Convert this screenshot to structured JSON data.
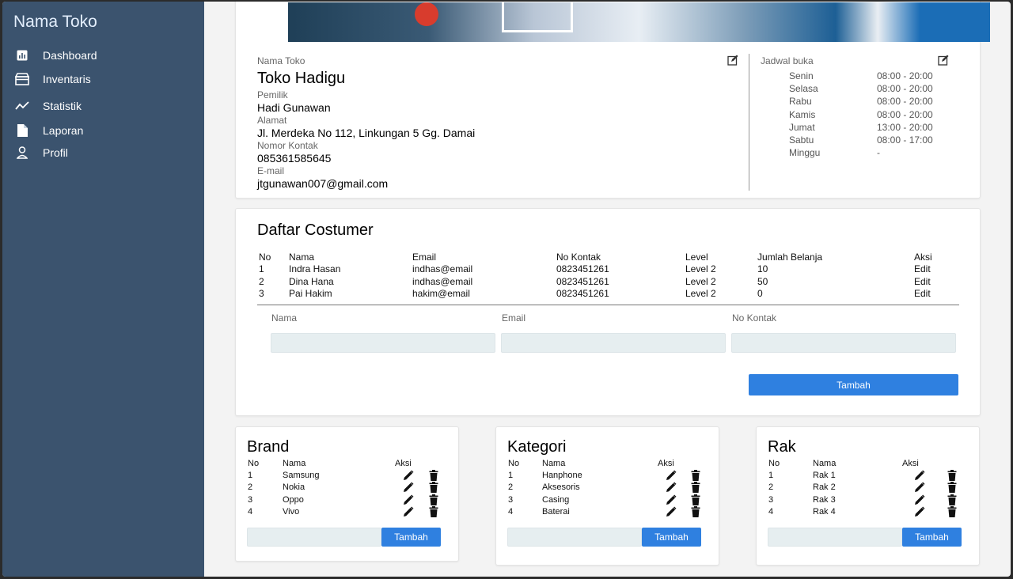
{
  "app": {
    "title": "Nama Toko"
  },
  "sidebar": {
    "items": [
      {
        "label": "Dashboard",
        "icon": "bar-chart-icon"
      },
      {
        "label": "Inventaris",
        "icon": "storefront-icon"
      },
      {
        "label": "Statistik",
        "icon": "trend-icon"
      },
      {
        "label": "Laporan",
        "icon": "document-icon"
      },
      {
        "label": "Profil",
        "icon": "person-icon"
      }
    ]
  },
  "store": {
    "name_label": "Nama Toko",
    "name": "Toko Hadigu",
    "owner_label": "Pemilik",
    "owner": "Hadi Gunawan",
    "address_label": "Alamat",
    "address": "Jl. Merdeka No 112, Linkungan 5 Gg. Damai",
    "contact_label": "Nomor Kontak",
    "contact": "085361585645",
    "email_label": "E-mail",
    "email": "jtgunawan007@gmail.com"
  },
  "schedule": {
    "title": "Jadwal buka",
    "days": [
      {
        "day": "Senin",
        "time": "08:00 - 20:00"
      },
      {
        "day": "Selasa",
        "time": "08:00 - 20:00"
      },
      {
        "day": "Rabu",
        "time": "08:00 - 20:00"
      },
      {
        "day": "Kamis",
        "time": "08:00 - 20:00"
      },
      {
        "day": "Jumat",
        "time": "13:00 - 20:00"
      },
      {
        "day": "Sabtu",
        "time": "08:00 - 17:00"
      },
      {
        "day": "Minggu",
        "time": "-"
      }
    ]
  },
  "customers": {
    "title": "Daftar Costumer",
    "headers": [
      "No",
      "Nama",
      "Email",
      "No Kontak",
      "Level",
      "Jumlah Belanja",
      "Aksi"
    ],
    "rows": [
      [
        "1",
        "Indra Hasan",
        "indhas@email",
        "0823451261",
        "Level 2",
        "10",
        "Edit"
      ],
      [
        "2",
        "Dina Hana",
        "indhas@email",
        "0823451261",
        "Level 2",
        "50",
        "Edit"
      ],
      [
        "3",
        "Pai Hakim",
        "hakim@email",
        "0823451261",
        "Level 2",
        "0",
        "Edit"
      ]
    ],
    "form": {
      "name_label": "Nama",
      "email_label": "Email",
      "contact_label": "No Kontak",
      "name_value": "",
      "email_value": "",
      "contact_value": ""
    },
    "add_label": "Tambah"
  },
  "brand": {
    "title": "Brand",
    "headers": [
      "No",
      "Nama",
      "Aksi"
    ],
    "rows": [
      [
        "1",
        "Samsung"
      ],
      [
        "2",
        "Nokia"
      ],
      [
        "3",
        "Oppo"
      ],
      [
        "4",
        "Vivo"
      ]
    ],
    "input_value": "",
    "add_label": "Tambah"
  },
  "kategori": {
    "title": "Kategori",
    "headers": [
      "No",
      "Nama",
      "Aksi"
    ],
    "rows": [
      [
        "1",
        "Hanphone"
      ],
      [
        "2",
        "Aksesoris"
      ],
      [
        "3",
        "Casing"
      ],
      [
        "4",
        "Baterai"
      ]
    ],
    "input_value": "",
    "add_label": "Tambah"
  },
  "rak": {
    "title": "Rak",
    "headers": [
      "No",
      "Nama",
      "Aksi"
    ],
    "rows": [
      [
        "1",
        "Rak 1"
      ],
      [
        "2",
        "Rak 2"
      ],
      [
        "3",
        "Rak 3"
      ],
      [
        "4",
        "Rak 4"
      ]
    ],
    "input_value": "",
    "add_label": "Tambah"
  },
  "colors": {
    "sidebar": "#3b536e",
    "accent": "#2f80e0",
    "input_bg": "#e6eef0"
  }
}
